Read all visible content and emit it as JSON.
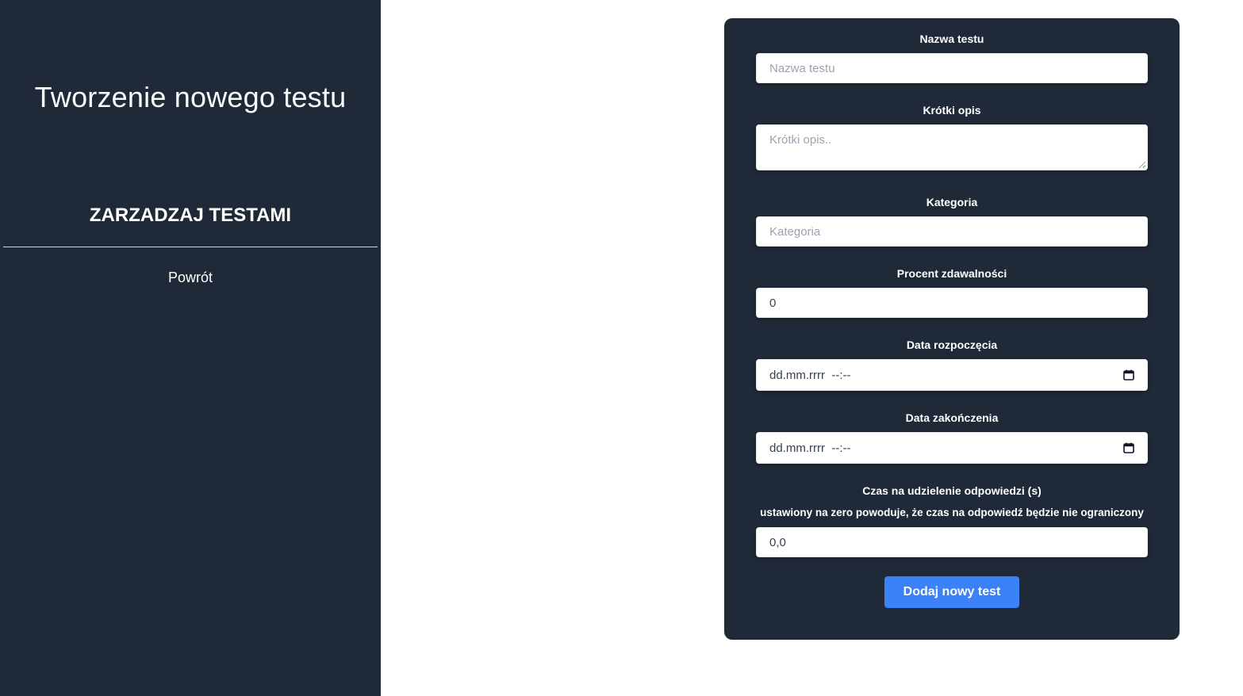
{
  "sidebar": {
    "title": "Tworzenie nowego testu",
    "section_heading": "ZARZADZAJ TESTAMI",
    "back_link": "Powrót"
  },
  "form": {
    "name": {
      "label": "Nazwa testu",
      "placeholder": "Nazwa testu",
      "value": ""
    },
    "description": {
      "label": "Krótki opis",
      "placeholder": "Krótki opis..",
      "value": ""
    },
    "category": {
      "label": "Kategoria",
      "placeholder": "Kategoria",
      "value": ""
    },
    "pass_percent": {
      "label": "Procent zdawalności",
      "value": "0"
    },
    "start_date": {
      "label": "Data rozpoczęcia",
      "value": "dd.mm.rrrr  --:--",
      "icon": "calendar-icon"
    },
    "end_date": {
      "label": "Data zakończenia",
      "value": "dd.mm.rrrr  --:--",
      "icon": "calendar-icon"
    },
    "answer_time": {
      "label": "Czas na udzielenie odpowiedzi (s)",
      "hint": "ustawiony na zero powoduje, że czas na odpowiedź będzie nie ograniczony",
      "value": "0,0"
    },
    "submit_label": "Dodaj nowy test"
  },
  "colors": {
    "panel_bg": "#1f2937",
    "accent": "#3b82f6",
    "page_bg": "#ffffff"
  }
}
